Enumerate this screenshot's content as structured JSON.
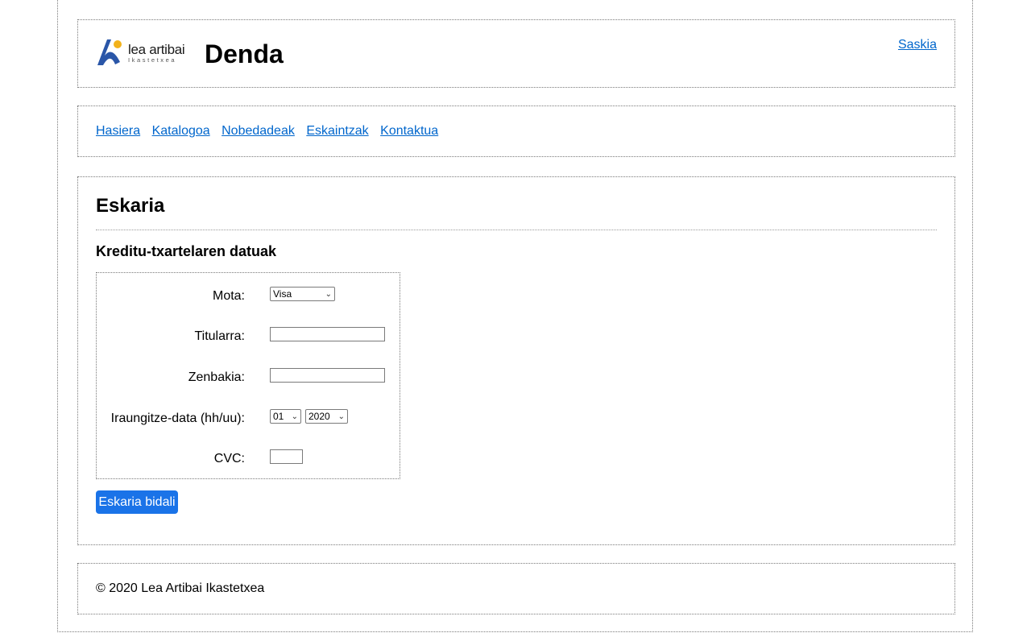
{
  "header": {
    "logo_text": "lea artibai",
    "logo_subtext": "Ikastetxea",
    "title": "Denda",
    "cart_link": "Saskia"
  },
  "nav": {
    "items": [
      {
        "label": "Hasiera"
      },
      {
        "label": "Katalogoa"
      },
      {
        "label": "Nobedadeak"
      },
      {
        "label": "Eskaintzak"
      },
      {
        "label": "Kontaktua"
      }
    ]
  },
  "main": {
    "heading": "Eskaria",
    "subheading": "Kreditu-txartelaren datuak",
    "form": {
      "type_label": "Mota:",
      "type_value": "Visa",
      "holder_label": "Titularra:",
      "holder_value": "",
      "number_label": "Zenbakia:",
      "number_value": "",
      "expiry_label": "Iraungitze-data (hh/uu):",
      "expiry_month": "01",
      "expiry_year": "2020",
      "cvc_label": "CVC:",
      "cvc_value": ""
    },
    "submit_label": "Eskaria bidali"
  },
  "footer": {
    "copyright": "© 2020 Lea Artibai Ikastetxea"
  },
  "colors": {
    "link": "#0066cc",
    "button": "#1a73e8",
    "logo_blue": "#2a56a8",
    "logo_yellow": "#f2b21b"
  }
}
